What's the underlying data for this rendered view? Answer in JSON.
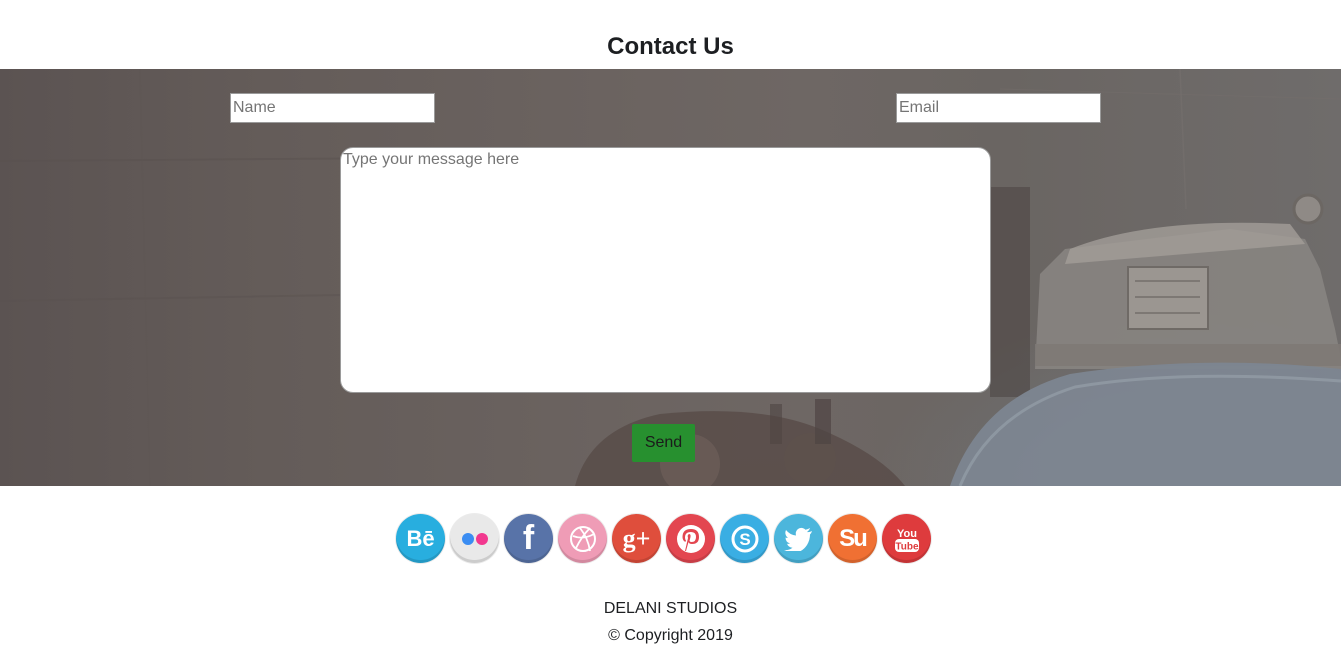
{
  "page_title": "Contact Us",
  "form": {
    "name_placeholder": "Name",
    "email_placeholder": "Email",
    "message_placeholder": "Type your message here",
    "send_label": "Send"
  },
  "colors": {
    "send_button": "#27902f",
    "hero_overlay": "#665f5c"
  },
  "social_icons": [
    {
      "name": "behance-icon",
      "color": "#28aedf",
      "glyph": "Bē"
    },
    {
      "name": "flickr-icon",
      "color": "#e9e9e9",
      "glyph": ""
    },
    {
      "name": "facebook-icon",
      "color": "#5873a8",
      "glyph": "f"
    },
    {
      "name": "dribbble-icon",
      "color": "#ef9cb6",
      "glyph": ""
    },
    {
      "name": "google-plus-icon",
      "color": "#df4e3c",
      "glyph": "g+"
    },
    {
      "name": "pinterest-icon",
      "color": "#e34650",
      "glyph": ""
    },
    {
      "name": "skype-icon",
      "color": "#3aaee3",
      "glyph": ""
    },
    {
      "name": "twitter-icon",
      "color": "#4cb6dc",
      "glyph": ""
    },
    {
      "name": "stumbleupon-icon",
      "color": "#f07033",
      "glyph": "Su"
    },
    {
      "name": "youtube-icon",
      "color": "#de3b3d",
      "glyph": ""
    }
  ],
  "footer": {
    "brand": "DELANI STUDIOS",
    "copyright": "© Copyright 2019"
  }
}
